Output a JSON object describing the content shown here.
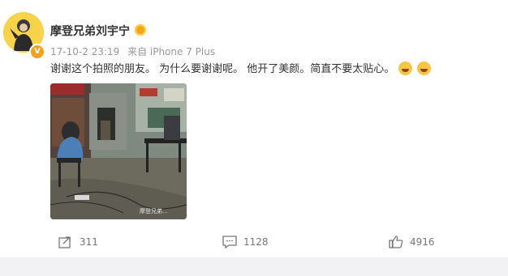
{
  "post": {
    "author_name": "摩登兄弟刘宇宁",
    "date": "17-10-2 23:19",
    "source": "来自 iPhone 7 Plus",
    "content": "谢谢这个拍照的朋友。 为什么要谢谢呢。 他开了美颜。简直不要太贴心。",
    "emojis": [
      "laugh-emoji",
      "laugh-emoji"
    ],
    "photo_watermark": "摩登兄弟..."
  },
  "actions": {
    "repost_count": "311",
    "comment_count": "1128",
    "like_count": "4916"
  },
  "colors": {
    "accent_orange": "#f5a11c",
    "text_primary": "#333333",
    "text_meta": "#999999",
    "background_strip": "#f2f2f5"
  }
}
